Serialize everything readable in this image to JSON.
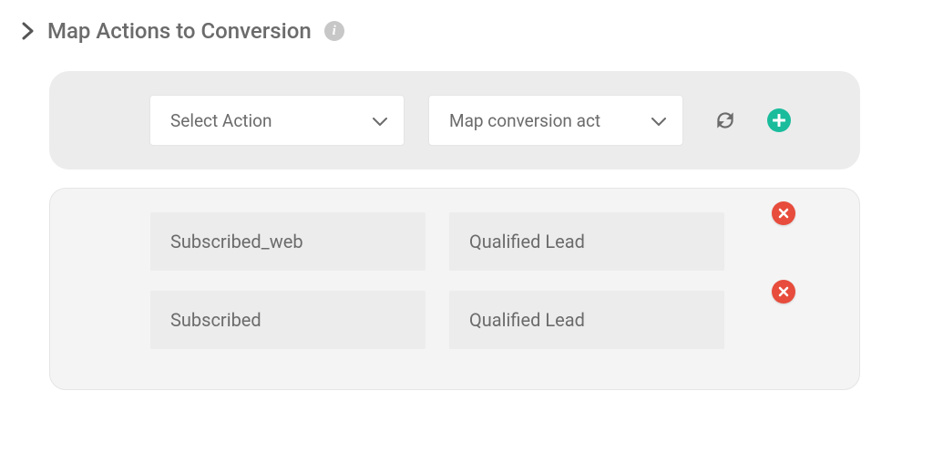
{
  "header": {
    "title": "Map Actions to Conversion"
  },
  "selector": {
    "action_placeholder": "Select Action",
    "conversion_placeholder": "Map conversion act"
  },
  "mappings": [
    {
      "action": "Subscribed_web",
      "conversion": "Qualified Lead"
    },
    {
      "action": "Subscribed",
      "conversion": "Qualified Lead"
    }
  ],
  "colors": {
    "accent_add": "#1abc9c",
    "accent_remove": "#e74c3c"
  }
}
